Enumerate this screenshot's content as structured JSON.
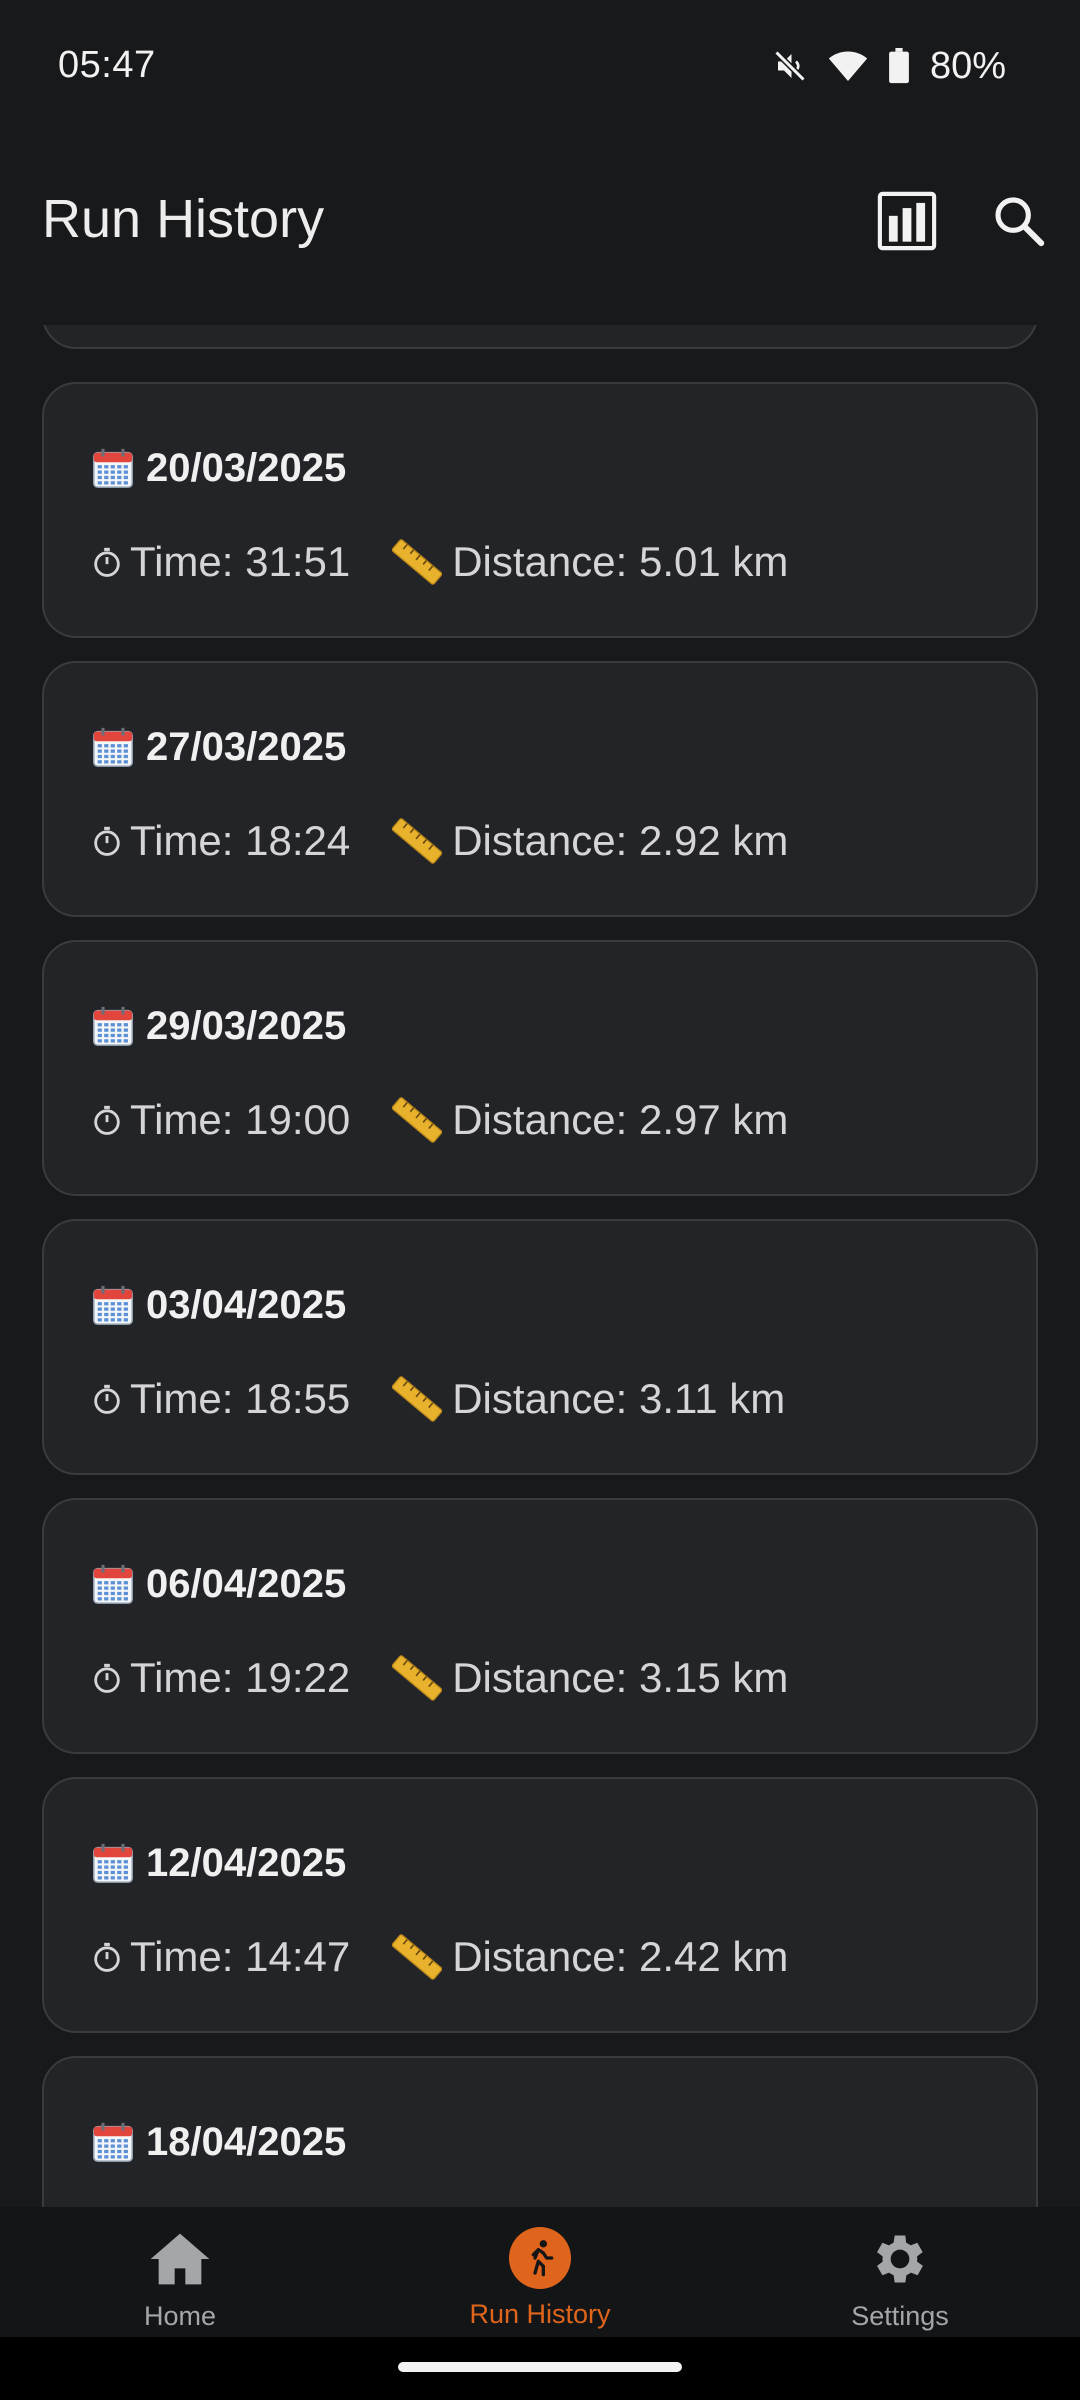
{
  "status_bar": {
    "time": "05:47",
    "battery": "80%",
    "icons": [
      "mute-icon",
      "wifi-icon",
      "battery-icon"
    ]
  },
  "app_bar": {
    "title": "Run History",
    "actions": [
      "stats-icon",
      "search-icon"
    ]
  },
  "runs": [
    {
      "date": "20/03/2025",
      "time": "Time: 31:51",
      "distance": "Distance: 5.01 km"
    },
    {
      "date": "27/03/2025",
      "time": "Time: 18:24",
      "distance": "Distance: 2.92 km"
    },
    {
      "date": "29/03/2025",
      "time": "Time: 19:00",
      "distance": "Distance: 2.97 km"
    },
    {
      "date": "03/04/2025",
      "time": "Time: 18:55",
      "distance": "Distance: 3.11 km"
    },
    {
      "date": "06/04/2025",
      "time": "Time: 19:22",
      "distance": "Distance: 3.15 km"
    },
    {
      "date": "12/04/2025",
      "time": "Time: 14:47",
      "distance": "Distance: 2.42 km"
    },
    {
      "date": "18/04/2025",
      "time": "",
      "distance": ""
    }
  ],
  "bottom_nav": {
    "items": [
      {
        "label": "Home",
        "icon": "home-icon",
        "active": false
      },
      {
        "label": "Run History",
        "icon": "run-icon",
        "active": true
      },
      {
        "label": "Settings",
        "icon": "gear-icon",
        "active": false
      }
    ]
  },
  "colors": {
    "background": "#18191b",
    "card": "#232427",
    "card_border": "#3a3b3f",
    "accent": "#e0651c",
    "nav_inactive": "#a5a6aa"
  }
}
